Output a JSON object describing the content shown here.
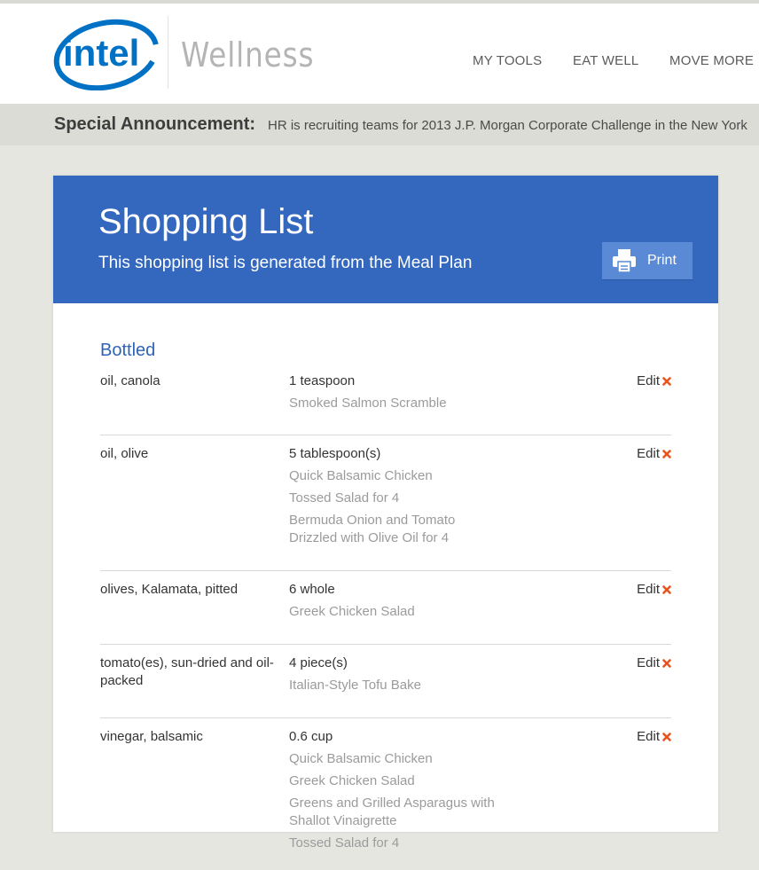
{
  "brand": {
    "logo_text": "intel",
    "sub_brand": "Wellness"
  },
  "nav": {
    "items": [
      "MY TOOLS",
      "EAT WELL",
      "MOVE MORE"
    ]
  },
  "announcement": {
    "title": "Special Announcement:",
    "text": "HR is recruiting teams for 2013 J.P. Morgan Corporate Challenge in the New York"
  },
  "banner": {
    "title": "Shopping List",
    "subtitle": "This shopping list is generated from the Meal Plan",
    "print_label": "Print"
  },
  "section": {
    "title": "Bottled"
  },
  "edit_label": "Edit",
  "items": [
    {
      "name": "oil, canola",
      "qty": "1 teaspoon",
      "recipes": [
        "Smoked Salmon Scramble"
      ]
    },
    {
      "name": "oil, olive",
      "qty": "5 tablespoon(s)",
      "recipes": [
        "Quick Balsamic Chicken",
        "Tossed Salad for 4",
        "Bermuda Onion and Tomato Drizzled with Olive Oil for 4"
      ]
    },
    {
      "name": "olives, Kalamata, pitted",
      "qty": "6 whole",
      "recipes": [
        "Greek Chicken Salad"
      ]
    },
    {
      "name": "tomato(es), sun-dried and oil-packed",
      "qty": "4 piece(s)",
      "recipes": [
        "Italian-Style Tofu Bake"
      ]
    },
    {
      "name": "vinegar, balsamic",
      "qty": "0.6 cup",
      "recipes": [
        "Quick Balsamic Chicken",
        "Greek Chicken Salad",
        "Greens and Grilled Asparagus with Shallot Vinaigrette",
        "Tossed Salad for 4"
      ]
    }
  ],
  "colors": {
    "intel_blue": "#0071c5",
    "banner_blue": "#3468bf",
    "accent_orange": "#e8541e"
  }
}
